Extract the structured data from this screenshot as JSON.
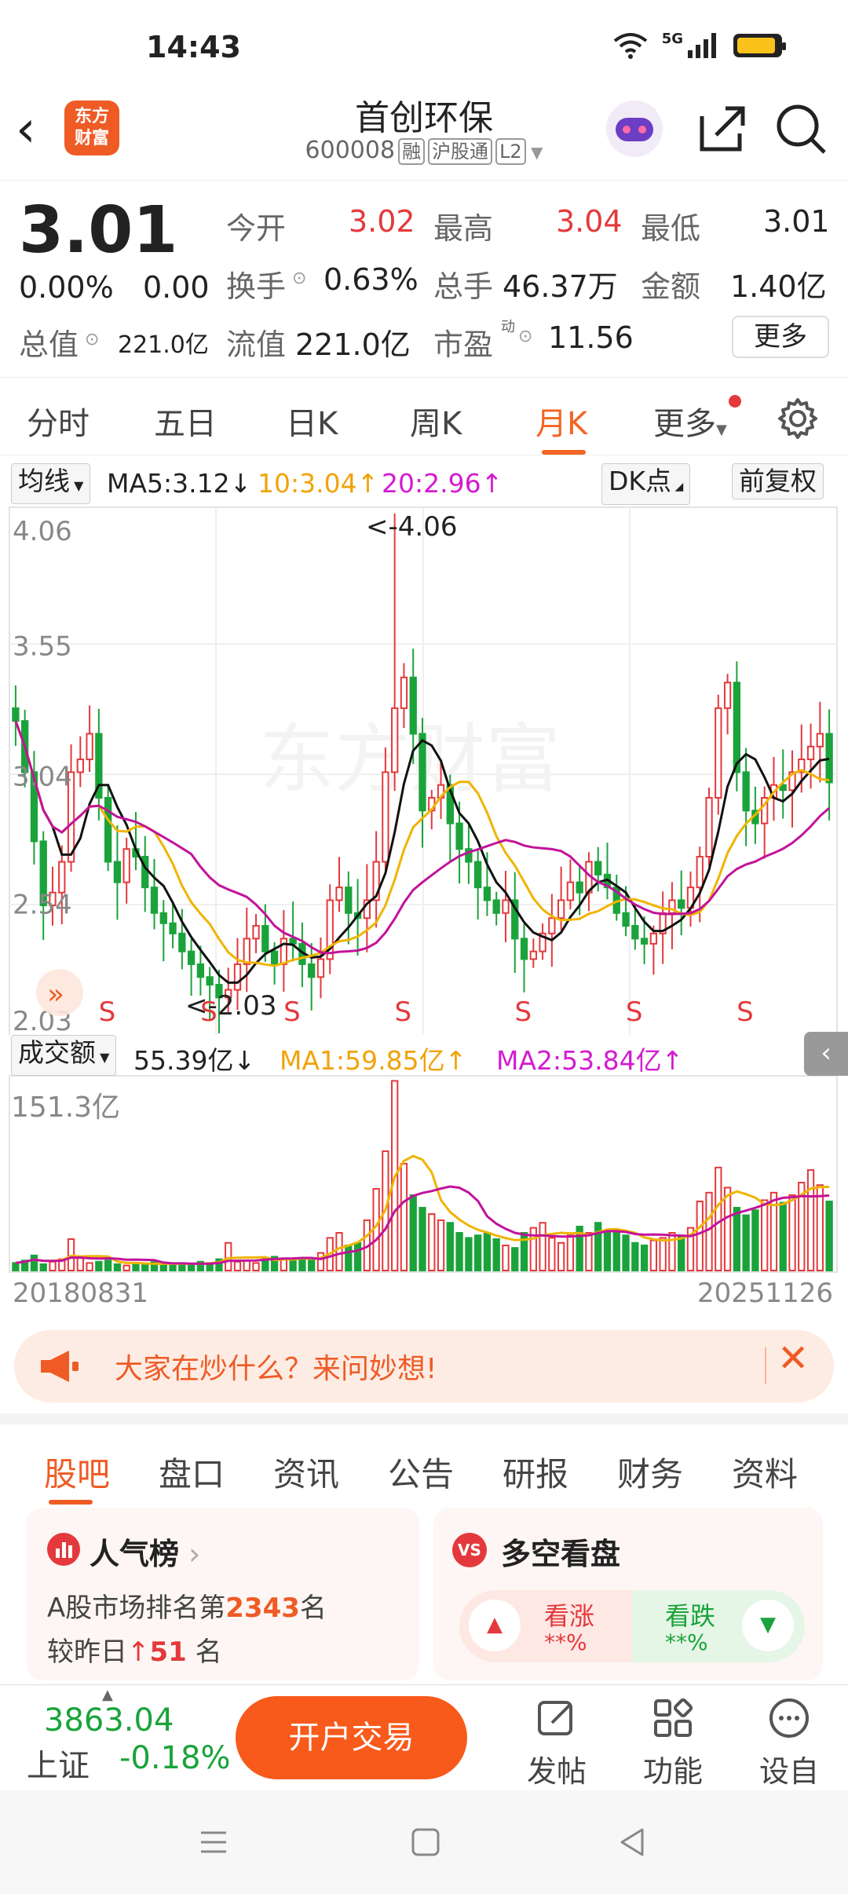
{
  "status": {
    "time": "14:43",
    "network": "5G"
  },
  "header": {
    "logo_line1": "东方",
    "logo_line2": "财富",
    "title": "首创环保",
    "code": "600008",
    "tags": [
      "融",
      "沪股通",
      "L2"
    ]
  },
  "quote": {
    "price": "3.01",
    "change_pct": "0.00%",
    "change": "0.00",
    "open_label": "今开",
    "open": "3.02",
    "high_label": "最高",
    "high": "3.04",
    "low_label": "最低",
    "low": "3.01",
    "turnover_label": "换手",
    "turnover": "0.63%",
    "volume_label": "总手",
    "volume": "46.37万",
    "amount_label": "金额",
    "amount": "1.40亿",
    "mktcap_label": "总值",
    "mktcap": "221.0亿",
    "float_label": "流值",
    "float_cap": "221.0亿",
    "pe_label": "市盈",
    "pe_sup": "动",
    "pe": "11.56",
    "more": "更多"
  },
  "tabs": [
    "分时",
    "五日",
    "日K",
    "周K",
    "月K",
    "更多"
  ],
  "active_tab": "月K",
  "ma_bar": {
    "selector": "均线",
    "ma5": "MA5:3.12↓",
    "ma10": "10:3.04↑",
    "ma20": "20:2.96↑",
    "dk": "DK点",
    "adjust": "前复权"
  },
  "vol_bar": {
    "selector": "成交额",
    "value": "55.39亿↓",
    "ma1": "MA1:59.85亿↑",
    "ma2": "MA2:53.84亿↑"
  },
  "colors": {
    "up": "#e4393c",
    "down": "#1aa33b",
    "ma5": "#111111",
    "ma10": "#f0b400",
    "ma20": "#c2139a",
    "accent": "#f26522"
  },
  "chart_data": {
    "type": "candlestick",
    "period": "monthly",
    "y_labels": [
      "4.06",
      "3.55",
      "3.04",
      "2.54",
      "2.03"
    ],
    "ylim": [
      2.03,
      4.06
    ],
    "max_marker": "<-4.06",
    "min_marker": "<-2.03",
    "signal_label": "S",
    "volume_max_label": "151.3亿",
    "x_start": "20180831",
    "x_end": "20251126",
    "close": [
      3.25,
      3.05,
      2.78,
      2.53,
      2.58,
      2.7,
      3.05,
      3.1,
      3.2,
      2.95,
      2.7,
      2.62,
      2.75,
      2.72,
      2.6,
      2.5,
      2.46,
      2.42,
      2.35,
      2.3,
      2.25,
      2.22,
      2.17,
      2.2,
      2.3,
      2.4,
      2.45,
      2.35,
      2.3,
      2.4,
      2.38,
      2.3,
      2.25,
      2.32,
      2.55,
      2.6,
      2.5,
      2.48,
      2.55,
      2.7,
      3.05,
      3.3,
      3.42,
      3.2,
      2.9,
      2.95,
      3.0,
      2.85,
      2.75,
      2.7,
      2.6,
      2.55,
      2.5,
      2.55,
      2.4,
      2.32,
      2.35,
      2.42,
      2.48,
      2.55,
      2.62,
      2.58,
      2.7,
      2.65,
      2.6,
      2.5,
      2.45,
      2.4,
      2.38,
      2.42,
      2.5,
      2.55,
      2.52,
      2.6,
      2.72,
      2.95,
      3.3,
      3.4,
      3.05,
      2.9,
      2.85,
      2.95,
      3.0,
      2.98,
      3.05,
      3.1,
      3.15,
      3.2,
      3.01
    ],
    "volume": [
      6,
      8,
      12,
      5,
      7,
      9,
      25,
      10,
      6,
      7,
      8,
      5,
      4,
      6,
      5,
      7,
      5,
      4,
      6,
      5,
      7,
      6,
      9,
      22,
      7,
      8,
      6,
      10,
      11,
      9,
      8,
      10,
      9,
      14,
      26,
      30,
      20,
      22,
      40,
      65,
      95,
      151,
      85,
      60,
      50,
      45,
      40,
      38,
      30,
      26,
      28,
      30,
      25,
      20,
      18,
      30,
      34,
      38,
      26,
      22,
      28,
      35,
      30,
      38,
      32,
      30,
      28,
      22,
      20,
      24,
      26,
      30,
      28,
      34,
      55,
      62,
      82,
      66,
      50,
      44,
      48,
      56,
      62,
      54,
      60,
      70,
      80,
      68,
      55
    ]
  },
  "ask": {
    "text": "大家在炒什么？来问妙想!"
  },
  "sections": [
    "股吧",
    "盘口",
    "资讯",
    "公告",
    "研报",
    "财务",
    "资料"
  ],
  "active_section": "股吧",
  "card_left": {
    "title": "人气榜",
    "rank_prefix": "A股市场排名第",
    "rank": "2343",
    "rank_suffix": "名",
    "delta_prefix": "较昨日",
    "delta": "51",
    "delta_suffix": " 名"
  },
  "card_right": {
    "title": "多空看盘",
    "bull_label": "看涨",
    "bull_value": "**%",
    "bear_label": "看跌",
    "bear_value": "**%"
  },
  "bottom": {
    "index_value": "3863.04",
    "index_name": "上证",
    "index_change": "-0.18%",
    "open_account": "开户交易",
    "post": "发帖",
    "functions": "功能",
    "watchlist": "设自选"
  }
}
